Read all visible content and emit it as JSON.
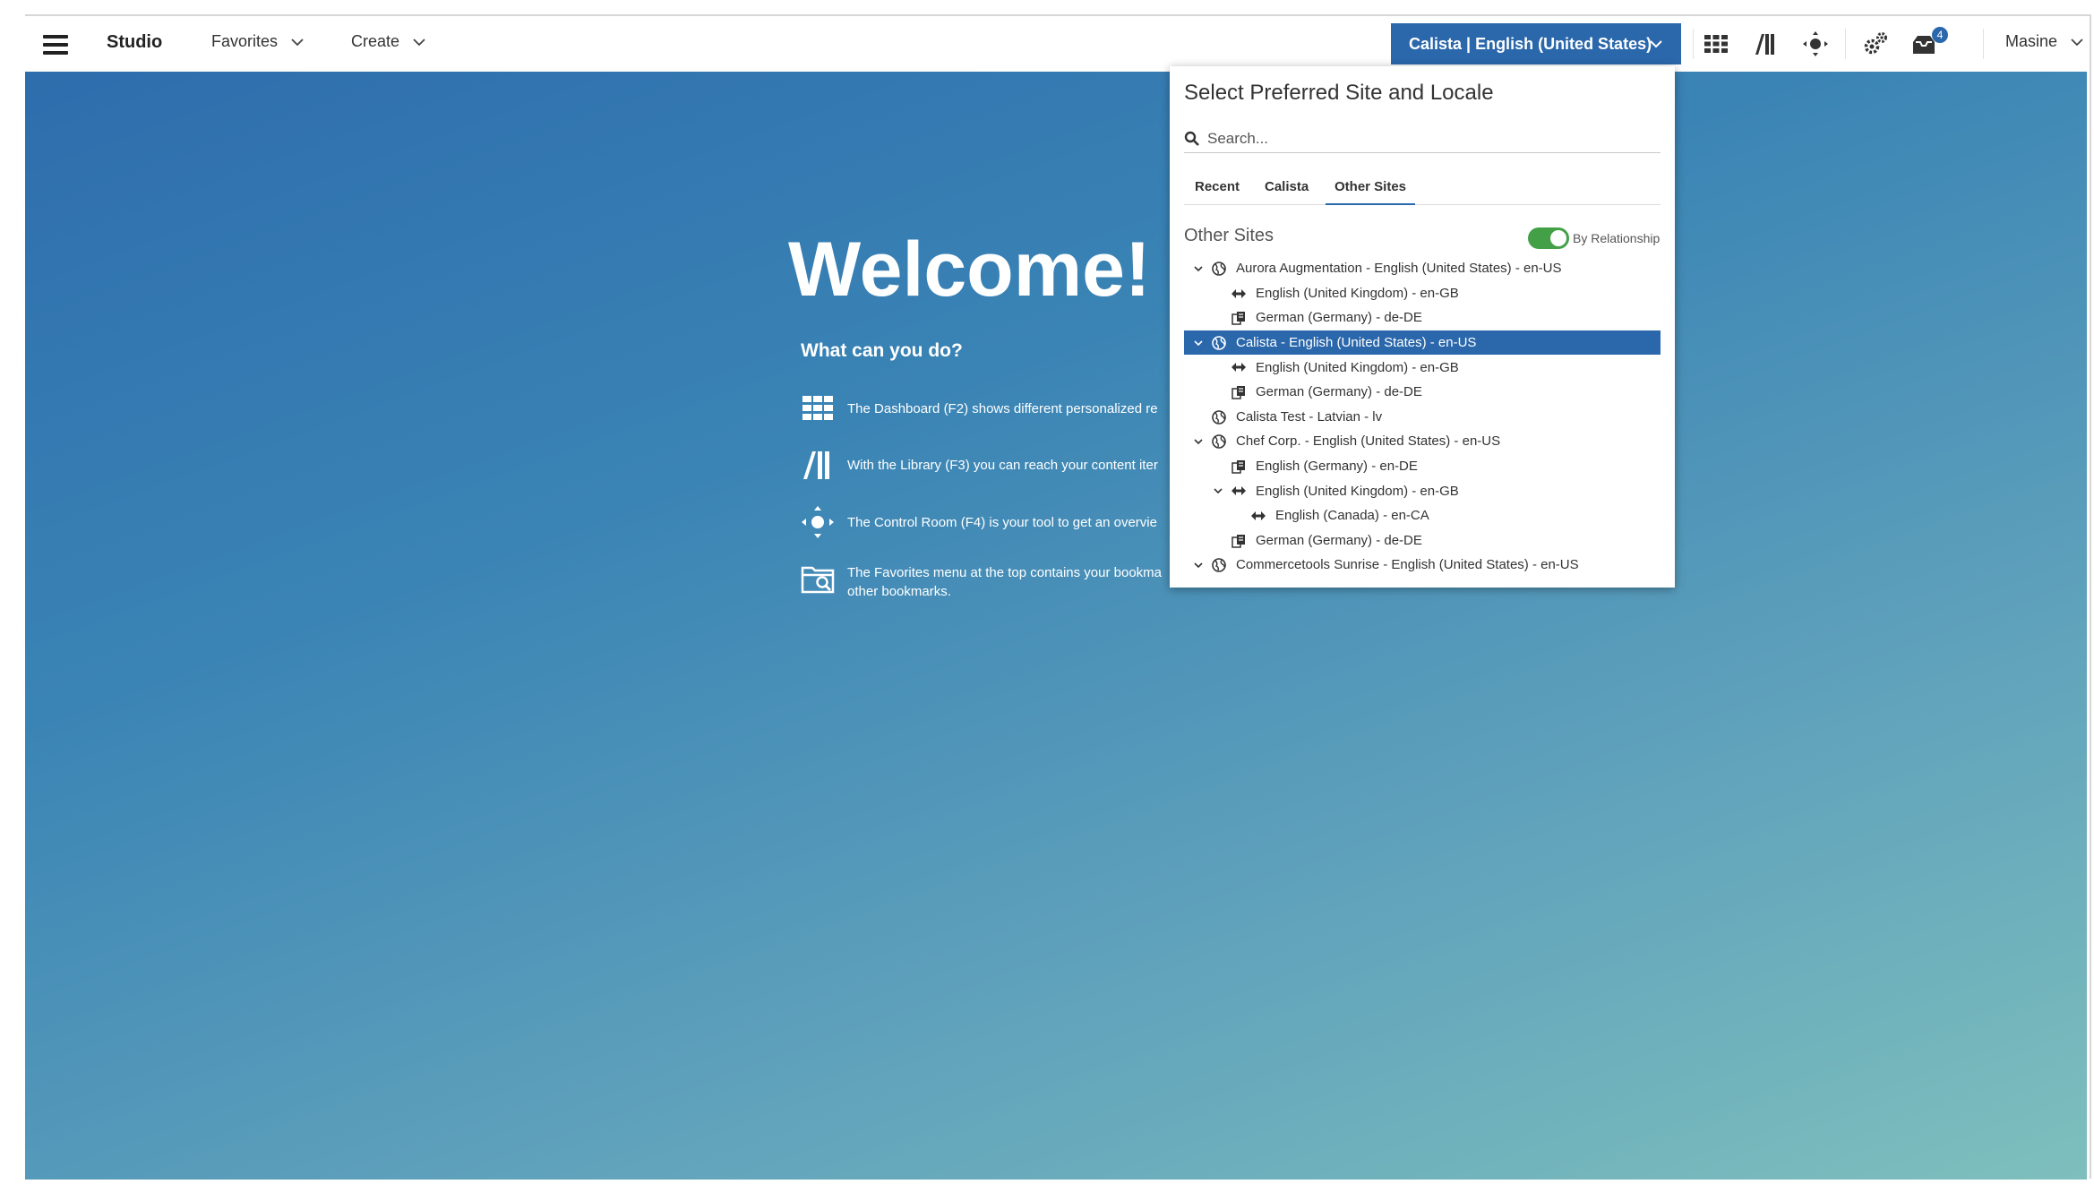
{
  "topbar": {
    "brand": "Studio",
    "favorites_label": "Favorites",
    "create_label": "Create",
    "site_locale_label": "Calista | English (United States)",
    "notification_count": "4",
    "user_label": "Masine"
  },
  "welcome": {
    "title": "Welcome!",
    "subtitle": "What can you do?",
    "tips": [
      {
        "icon": "dashboard-grid-icon",
        "text": "The Dashboard (F2) shows different personalized re"
      },
      {
        "icon": "library-icon",
        "text": "With the Library (F3) you can reach your content iter"
      },
      {
        "icon": "control-room-icon",
        "text": "The Control Room (F4) is your tool to get an overvie"
      },
      {
        "icon": "favorites-folder-icon",
        "text": "The Favorites menu at the top contains your bookma other bookmarks."
      }
    ]
  },
  "dropdown": {
    "title": "Select Preferred Site and Locale",
    "search_placeholder": "Search...",
    "tabs": [
      "Recent",
      "Calista",
      "Other Sites"
    ],
    "active_tab": "Other Sites",
    "section_title": "Other Sites",
    "toggle_label": "By Relationship",
    "toggle_on": true,
    "tree": [
      {
        "label": "Aurora Augmentation - English (United States) - en-US",
        "level": 0,
        "icon": "globe-icon",
        "expanded": true,
        "selected": false
      },
      {
        "label": "English (United Kingdom) - en-GB",
        "level": 1,
        "icon": "derived-arrows-icon",
        "expanded": false,
        "selected": false
      },
      {
        "label": "German (Germany) - de-DE",
        "level": 1,
        "icon": "translation-icon",
        "expanded": false,
        "selected": false
      },
      {
        "label": "Calista - English (United States) - en-US",
        "level": 0,
        "icon": "globe-icon",
        "expanded": true,
        "selected": true
      },
      {
        "label": "English (United Kingdom) - en-GB",
        "level": 1,
        "icon": "derived-arrows-icon",
        "expanded": false,
        "selected": false
      },
      {
        "label": "German (Germany) - de-DE",
        "level": 1,
        "icon": "translation-icon",
        "expanded": false,
        "selected": false
      },
      {
        "label": "Calista Test - Latvian - lv",
        "level": 0,
        "icon": "globe-icon",
        "expanded": false,
        "selected": false
      },
      {
        "label": "Chef Corp. - English (United States) - en-US",
        "level": 0,
        "icon": "globe-icon",
        "expanded": true,
        "selected": false
      },
      {
        "label": "English (Germany) - en-DE",
        "level": 1,
        "icon": "translation-icon",
        "expanded": false,
        "selected": false
      },
      {
        "label": "English (United Kingdom) - en-GB",
        "level": 1,
        "icon": "derived-arrows-icon",
        "expanded": true,
        "selected": false
      },
      {
        "label": "English (Canada) - en-CA",
        "level": 2,
        "icon": "derived-arrows-icon",
        "expanded": false,
        "selected": false
      },
      {
        "label": "German (Germany) - de-DE",
        "level": 1,
        "icon": "translation-icon",
        "expanded": false,
        "selected": false
      },
      {
        "label": "Commercetools Sunrise - English (United States) - en-US",
        "level": 0,
        "icon": "globe-icon",
        "expanded": true,
        "selected": false
      }
    ]
  },
  "colors": {
    "accent": "#2a67ab",
    "toggle_on": "#43a047",
    "gradient_start": "#2e6dad",
    "gradient_end": "#7ebfbd"
  }
}
